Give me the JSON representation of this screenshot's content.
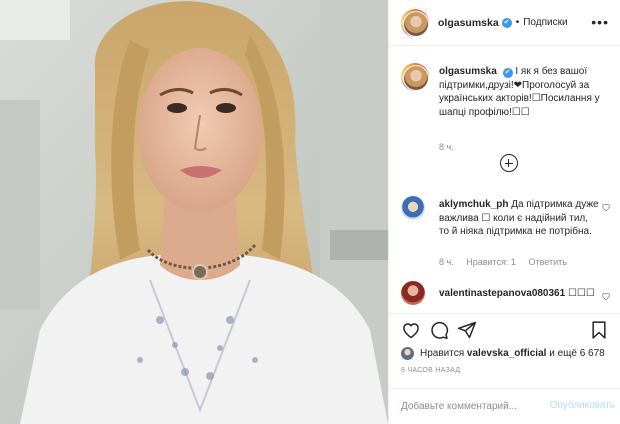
{
  "header": {
    "username": "olgasumska",
    "verified_mark": "✔",
    "separator": "•",
    "follow_label": "Подписки",
    "more_icon": "more-horizontal-icon"
  },
  "caption": {
    "username": "olgasumska",
    "verified_mark": "✔",
    "text": "І як я без вашої підтримки,друзі!❤Проголосуй за українських акторів!☐Посилання у шапці профілю!☐☐",
    "time": "8 ч."
  },
  "load_more_icon": "plus-circle-icon",
  "comments": [
    {
      "username": "aklymchuk_ph",
      "text": "Да підтримка дуже важлива ☐ коли є надійний тил, то й ніяка підтримка не потрібна.",
      "time": "8 ч.",
      "likes_label": "Нравится: 1",
      "reply_label": "Ответить"
    },
    {
      "username": "valentinastepanova080361",
      "text": "☐☐☐"
    }
  ],
  "actions": {
    "like_icon": "heart-icon",
    "comment_icon": "comment-icon",
    "share_icon": "paper-plane-icon",
    "save_icon": "bookmark-icon"
  },
  "likes": {
    "prefix": "Нравится",
    "user": "valevska_official",
    "suffix": "и ещё 6 678"
  },
  "posted_ago": "8 ЧАСОВ НАЗАД",
  "add_comment": {
    "placeholder": "Добавьте комментарий...",
    "publish_label": "Опубликовать"
  },
  "colors": {
    "accent_blue": "#3897f0",
    "publish_disabled": "#b3dbff",
    "muted_text": "#8e8e8e",
    "border": "#efefef"
  }
}
